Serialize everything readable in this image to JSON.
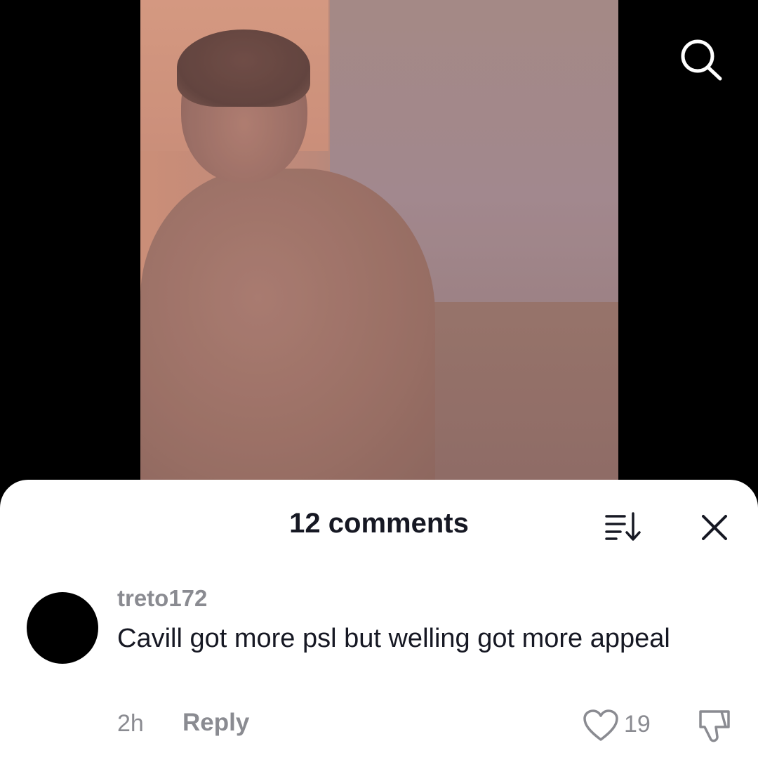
{
  "video": {
    "search_icon": "search-icon"
  },
  "comments_sheet": {
    "title": "12 comments",
    "sort_icon": "sort-icon",
    "close_icon": "close-icon",
    "comments": [
      {
        "username": "treto172",
        "text": "Cavill got more psl but welling got more appeal",
        "time": "2h",
        "reply_label": "Reply",
        "likes": "19",
        "like_icon": "heart-icon",
        "dislike_icon": "thumbs-down-icon"
      }
    ]
  },
  "colors": {
    "text_primary": "#161823",
    "text_secondary": "#8a8b91",
    "sheet_bg": "#ffffff",
    "page_bg": "#000000"
  }
}
